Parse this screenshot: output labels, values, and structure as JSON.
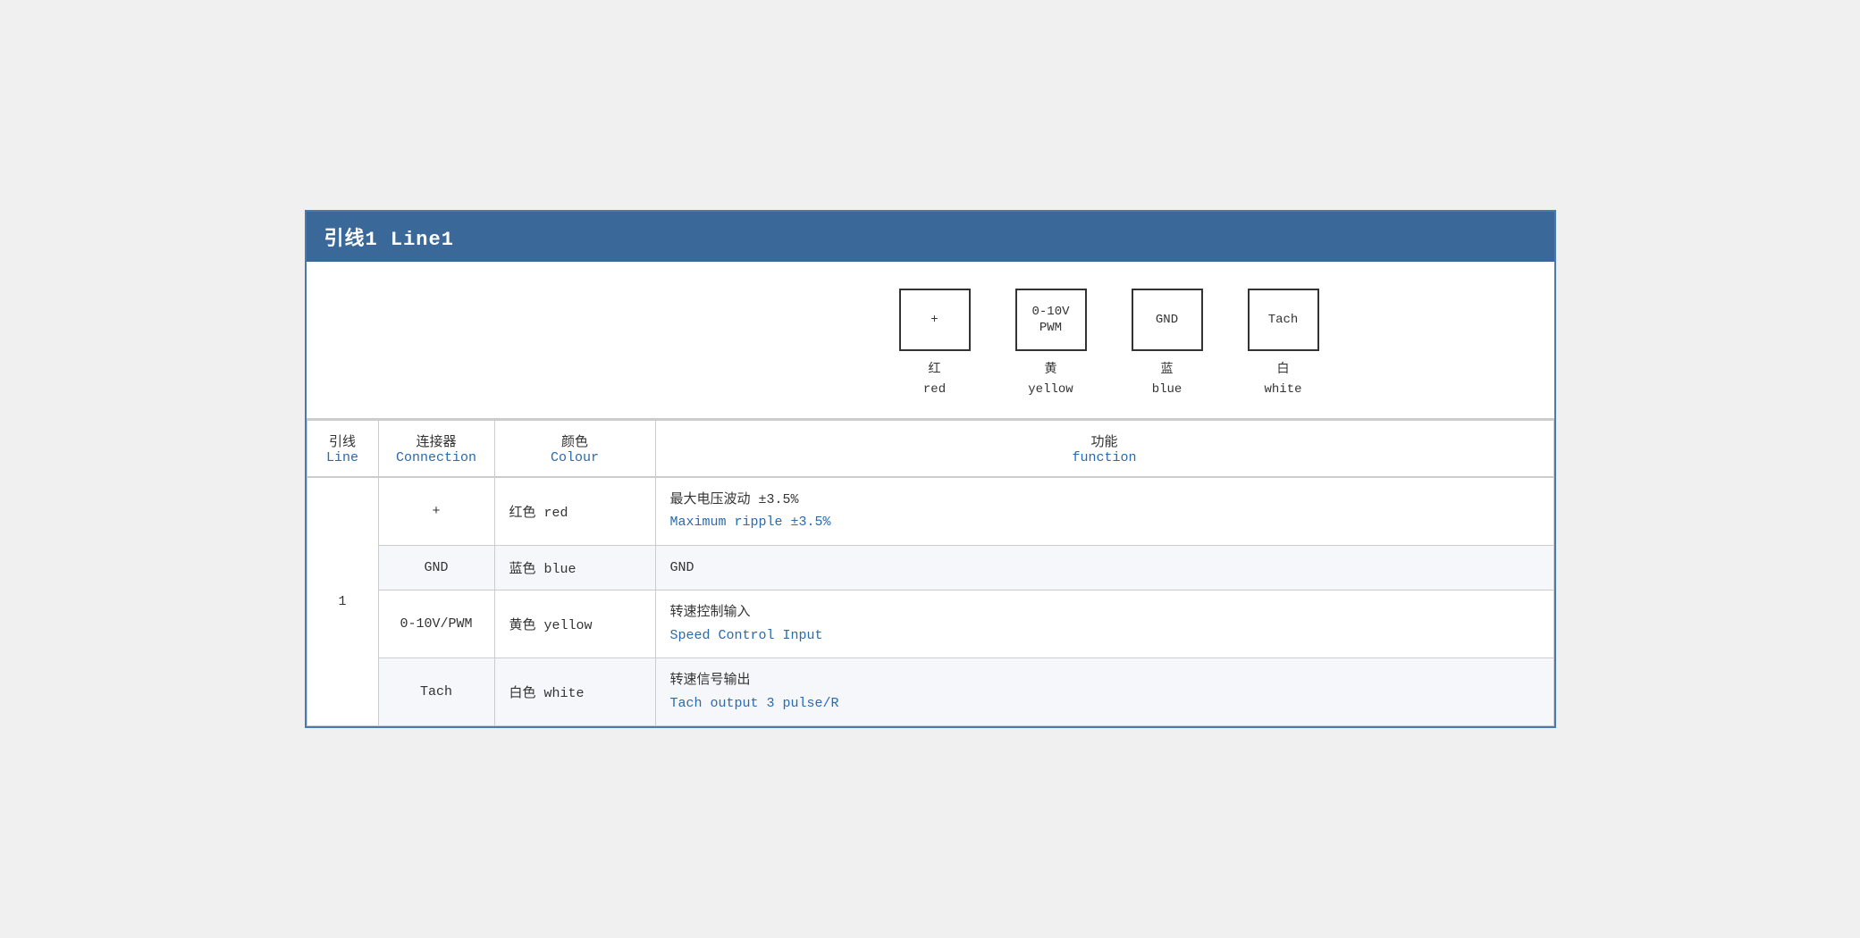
{
  "title": "引线1 Line1",
  "diagram": {
    "connectors": [
      {
        "id": "plus",
        "symbol": "+",
        "zh": "红",
        "en": "red"
      },
      {
        "id": "pwm",
        "symbol": "0-10V\nPWM",
        "zh": "黄",
        "en": "yellow"
      },
      {
        "id": "gnd",
        "symbol": "GND",
        "zh": "蓝",
        "en": "blue"
      },
      {
        "id": "tach",
        "symbol": "Tach",
        "zh": "白",
        "en": "white"
      }
    ]
  },
  "table": {
    "headers": {
      "line_zh": "引线",
      "line_en": "Line",
      "connection_zh": "连接器",
      "connection_en": "Connection",
      "colour_zh": "颜色",
      "colour_en": "Colour",
      "function_zh": "功能",
      "function_en": "function"
    },
    "rows": [
      {
        "line": "1",
        "connection": "+",
        "colour_zh": "红色",
        "colour_en": "red",
        "function_zh": "最大电压波动 ±3.5%",
        "function_en": "Maximum ripple ±3.5%",
        "alt": false
      },
      {
        "line": "",
        "connection": "GND",
        "colour_zh": "蓝色",
        "colour_en": "blue",
        "function_zh": "GND",
        "function_en": "",
        "alt": true
      },
      {
        "line": "",
        "connection": "0-10V/PWM",
        "colour_zh": "黄色",
        "colour_en": "yellow",
        "function_zh": "转速控制输入",
        "function_en": "Speed Control Input",
        "alt": false
      },
      {
        "line": "",
        "connection": "Tach",
        "colour_zh": "白色",
        "colour_en": "white",
        "function_zh": "转速信号输出",
        "function_en": "Tach output 3 pulse/R",
        "alt": true
      }
    ]
  }
}
